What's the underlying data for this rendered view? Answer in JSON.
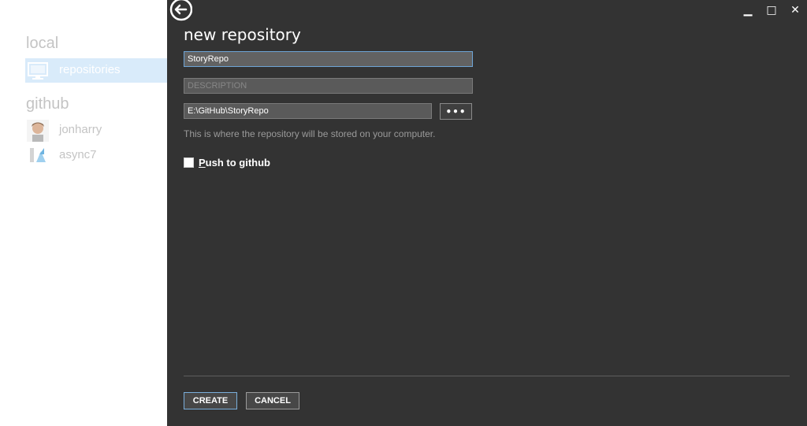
{
  "sidebar": {
    "local_title": "local",
    "local_items": [
      {
        "label": "repositories",
        "icon": "monitor-icon"
      }
    ],
    "github_title": "github",
    "github_items": [
      {
        "label": "jonharry",
        "icon": "avatar"
      },
      {
        "label": "async7",
        "icon": "org-avatar"
      }
    ]
  },
  "window": {
    "minimize": "▁",
    "maximize": "□",
    "close": "✕"
  },
  "form": {
    "title": "new repository",
    "name_value": "StoryRepo",
    "description_placeholder": "DESCRIPTION",
    "path_value": "E:\\GitHub\\StoryRepo",
    "browse_label": "•••",
    "path_help": "This is where the repository will be stored on your computer.",
    "push_label_accel": "P",
    "push_label_rest": "ush to github",
    "push_checked": false,
    "create_label": "CREATE",
    "cancel_label": "CANCEL"
  },
  "colors": {
    "panel": "#333333",
    "accent": "#6ea4d6",
    "selected_nav": "#d9ebfa"
  }
}
